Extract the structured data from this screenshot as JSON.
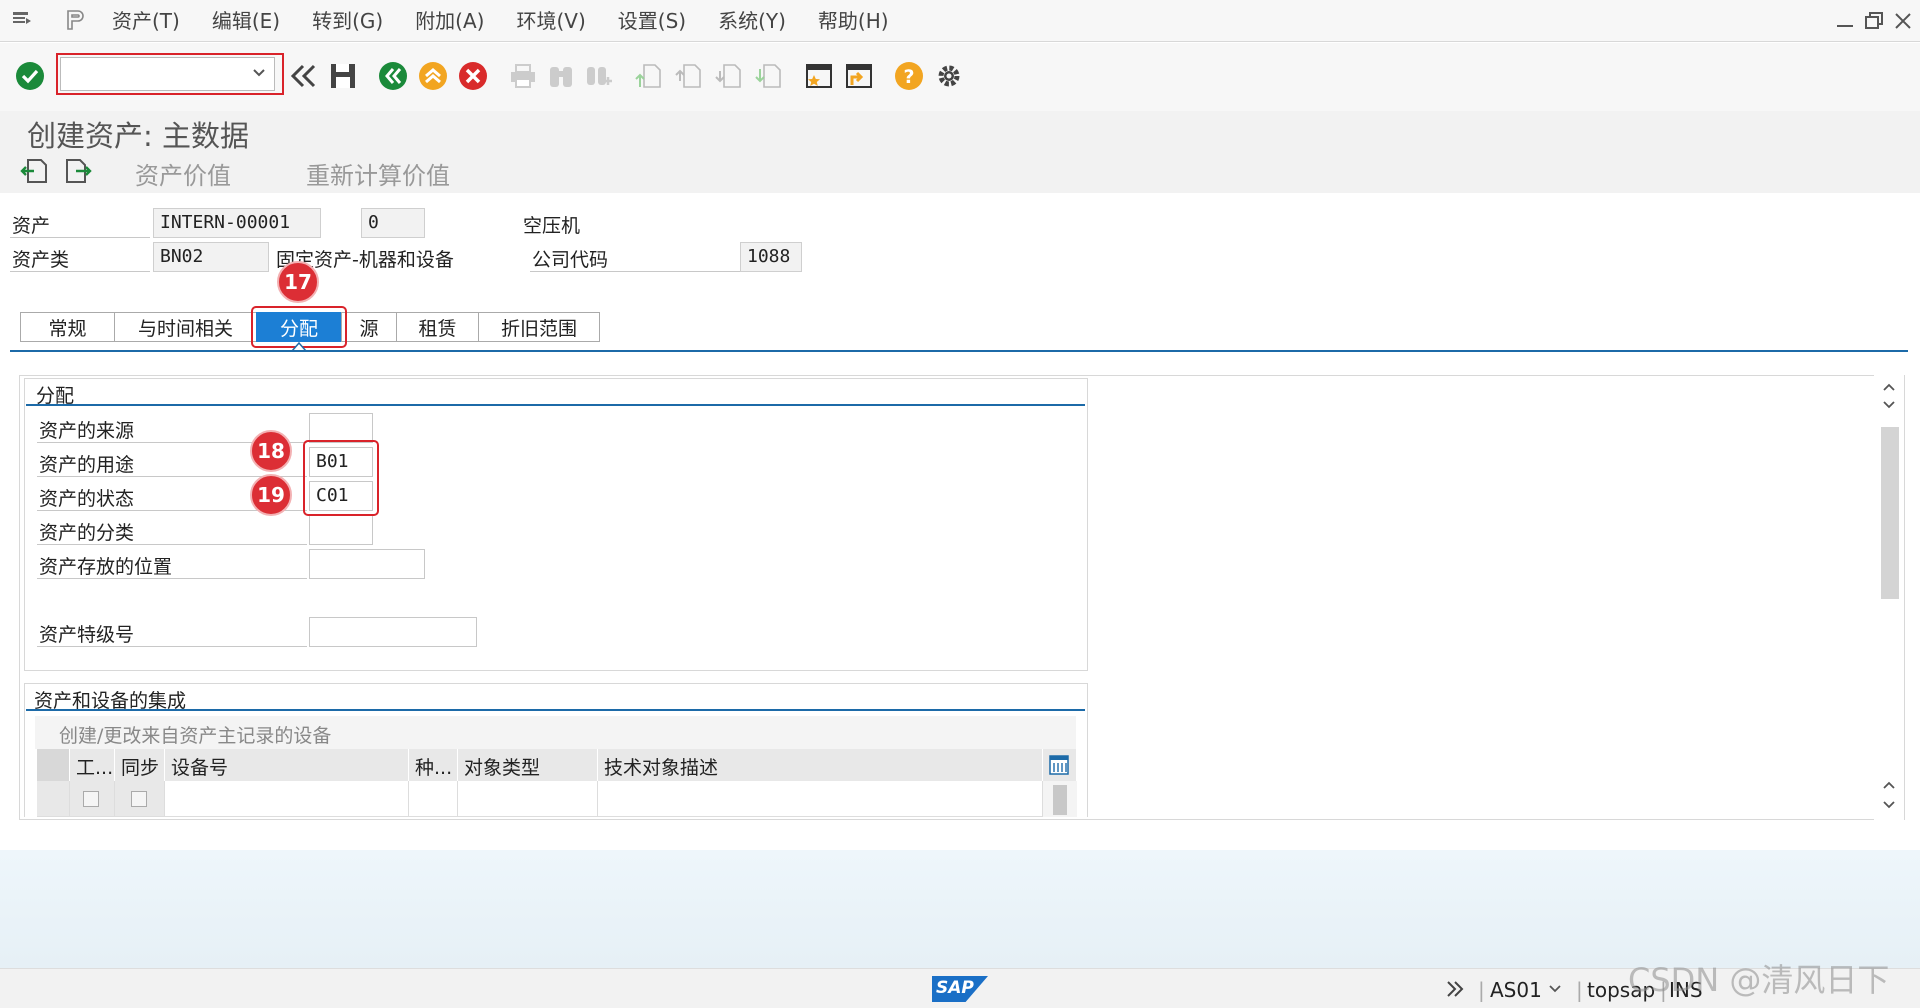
{
  "menubar": {
    "items": [
      "资产(T)",
      "编辑(E)",
      "转到(G)",
      "附加(A)",
      "环境(V)",
      "设置(S)",
      "系统(Y)",
      "帮助(H)"
    ]
  },
  "toolbar": {
    "command_field_value": "",
    "icons": [
      "check-icon",
      "double-left-icon",
      "save-icon",
      "back-icon",
      "exit-icon",
      "cancel-icon",
      "print-icon",
      "find-icon",
      "find-next-icon",
      "first-page-icon",
      "prev-page-icon",
      "next-page-icon",
      "last-page-icon",
      "create-session-icon",
      "shortcut-icon",
      "help-icon",
      "settings-icon"
    ]
  },
  "title": "创建资产:  主数据",
  "app_toolbar": {
    "asset_values": "资产价值",
    "recalculate_values": "重新计算价值"
  },
  "header": {
    "asset_label": "资产",
    "asset_value": "INTERN-00001",
    "subnumber_value": "0",
    "asset_description": "空压机",
    "asset_class_label": "资产类",
    "asset_class_value": "BN02",
    "asset_class_description": "固定资产-机器和设备",
    "company_code_label": "公司代码",
    "company_code_value": "1088"
  },
  "tabs": [
    {
      "label": "常规",
      "active": false
    },
    {
      "label": "与时间相关",
      "active": false
    },
    {
      "label": "分配",
      "active": true
    },
    {
      "label": "源",
      "active": false
    },
    {
      "label": "租赁",
      "active": false
    },
    {
      "label": "折旧范围",
      "active": false
    }
  ],
  "badges": {
    "b17": "17",
    "b18": "18",
    "b19": "19"
  },
  "assignment_group": {
    "title": "分配",
    "fields": [
      {
        "label": "资产的来源",
        "value": ""
      },
      {
        "label": "资产的用途",
        "value": "B01"
      },
      {
        "label": "资产的状态",
        "value": "C01"
      },
      {
        "label": "资产的分类",
        "value": ""
      },
      {
        "label": "资产存放的位置",
        "value": ""
      },
      {
        "label": "资产特级号",
        "value": ""
      }
    ]
  },
  "integration_group": {
    "title": "资产和设备的集成",
    "subtitle": "创建/更改来自资产主记录的设备",
    "columns": [
      "工...",
      "同步",
      "设备号",
      "种...",
      "对象类型",
      "技术对象描述"
    ]
  },
  "statusbar": {
    "sap_logo": "SAP",
    "transaction": "AS01",
    "server": "topsap",
    "mode": "INS"
  },
  "watermark": "CSDN @清风日下",
  "colors": {
    "accent": "#1c7fd5",
    "badge": "#dc2e35",
    "underline": "#1c6aa8"
  }
}
